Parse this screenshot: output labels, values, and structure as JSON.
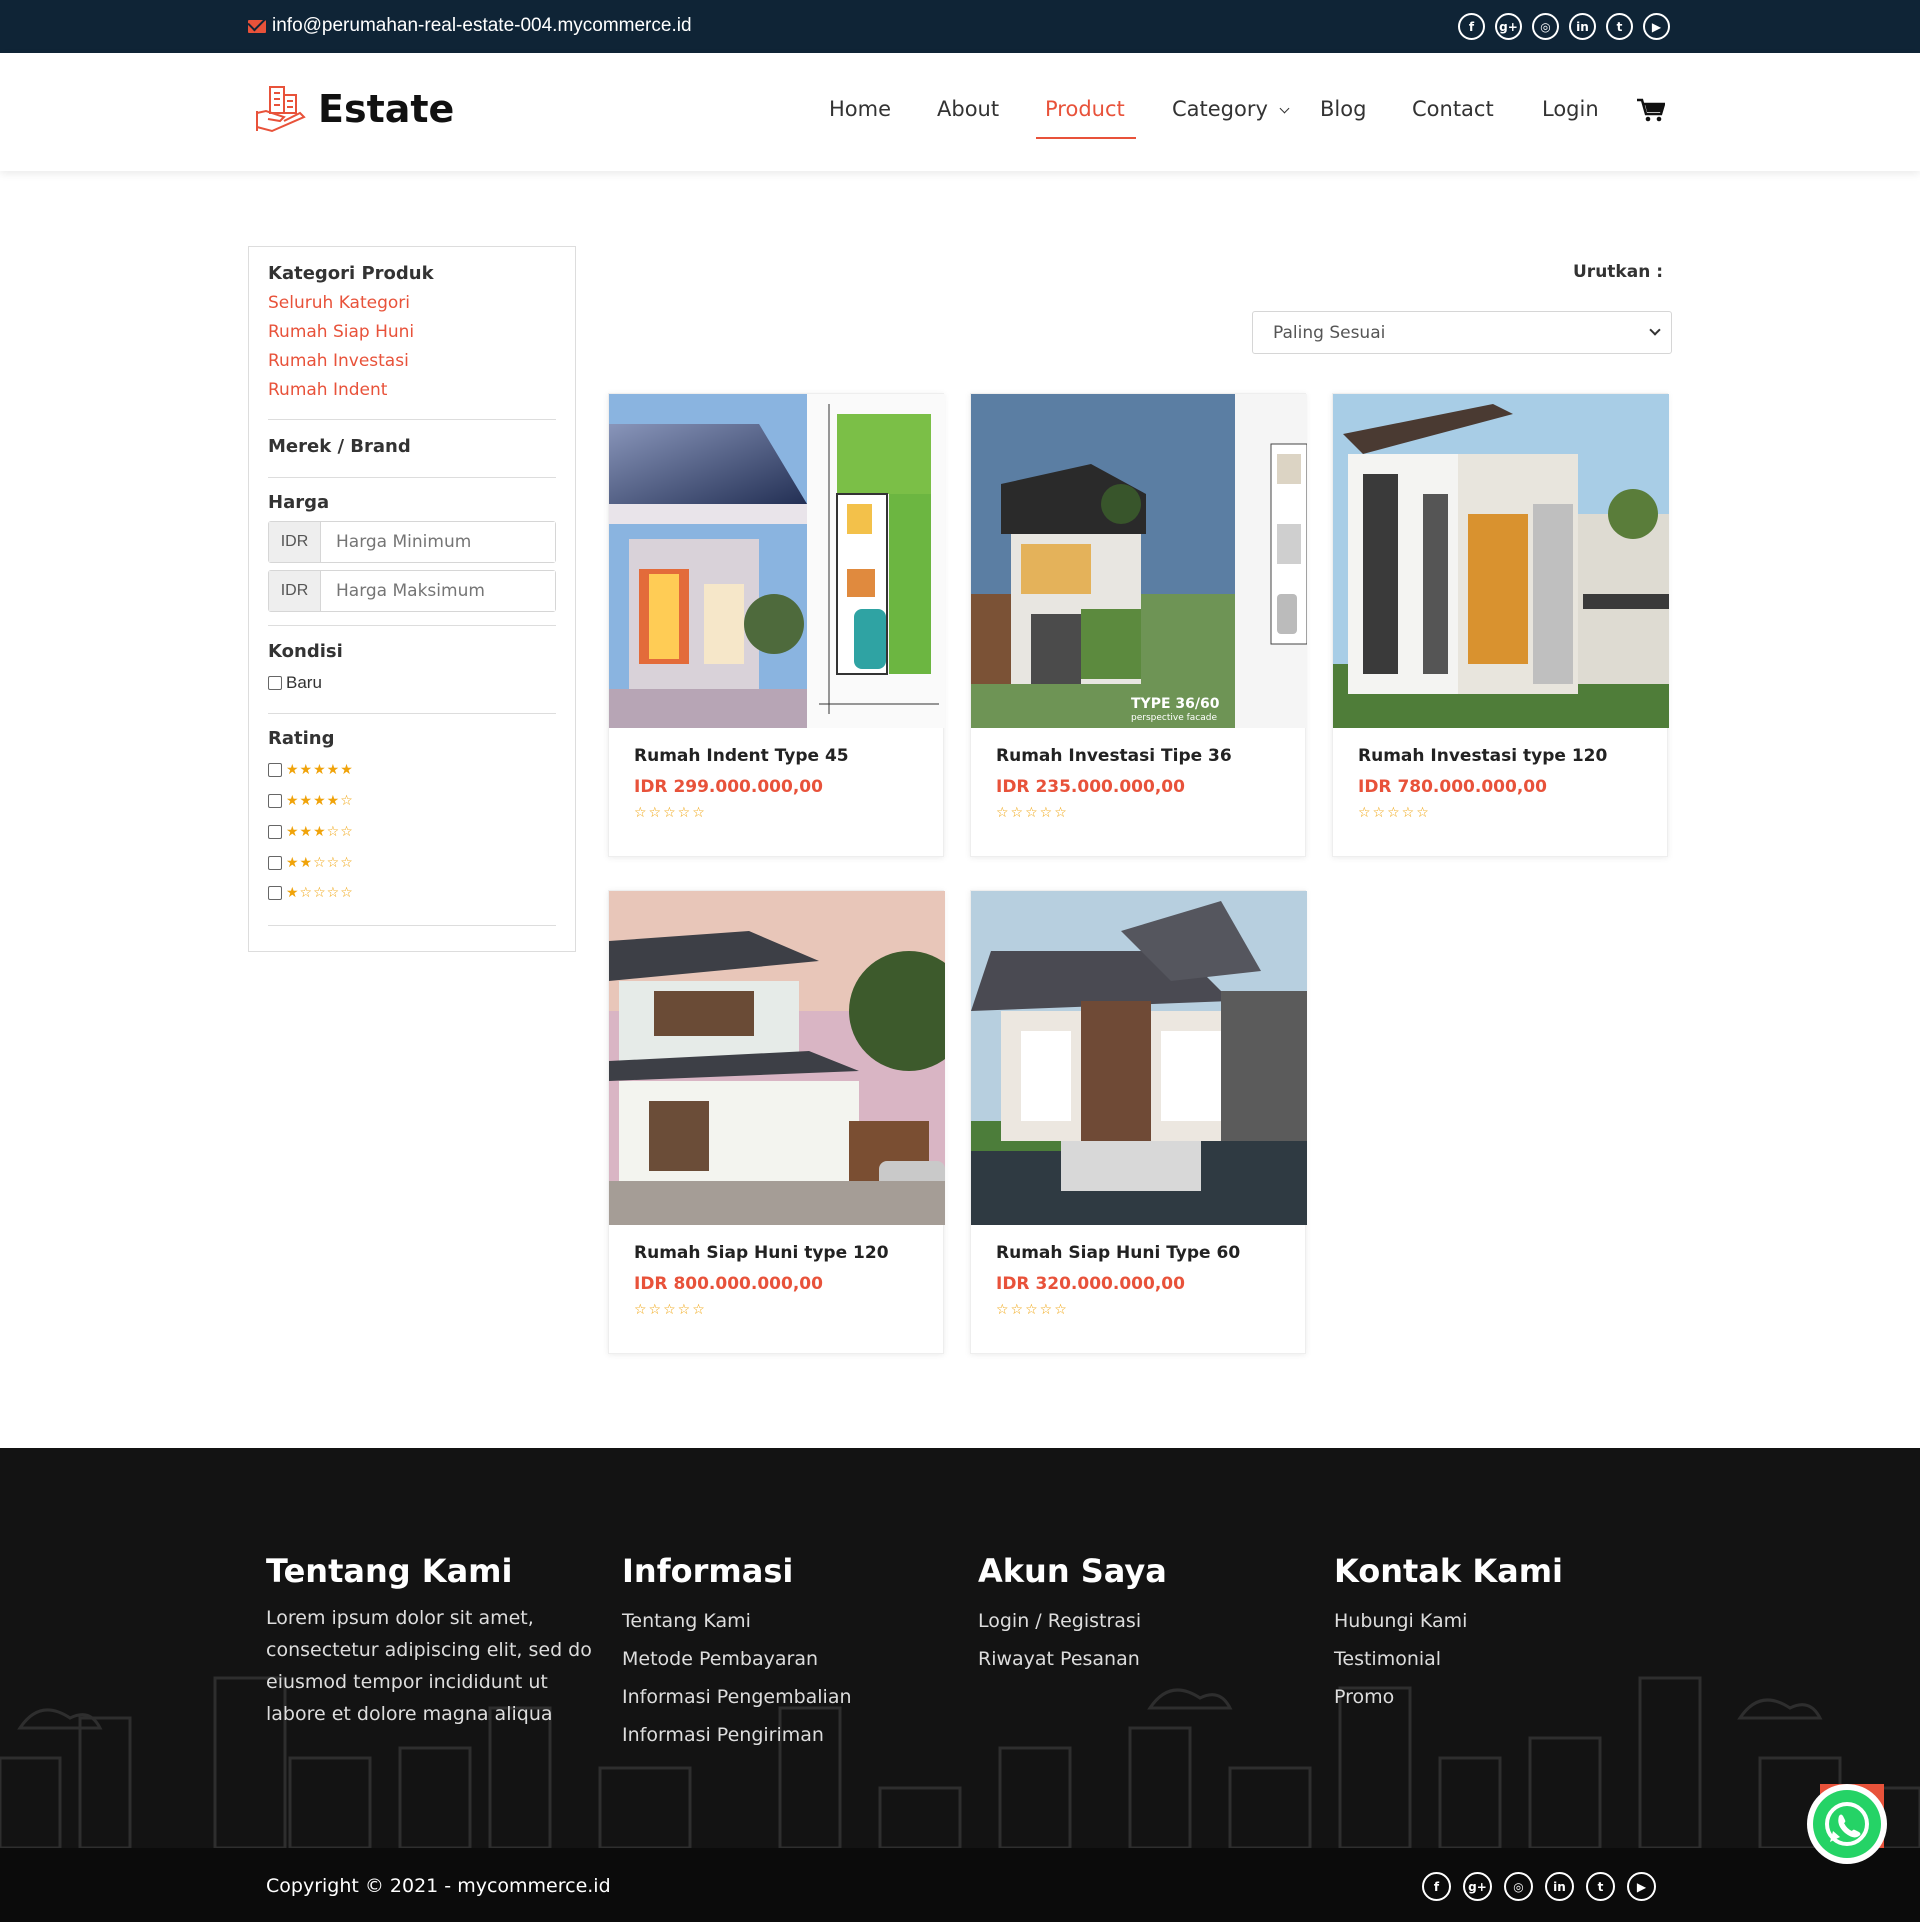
{
  "topbar": {
    "email": "info@perumahan-real-estate-004.mycommerce.id",
    "social": [
      {
        "icon": "facebook-icon",
        "glyph": "f"
      },
      {
        "icon": "google-plus-icon",
        "glyph": "g+"
      },
      {
        "icon": "instagram-icon",
        "glyph": "◎"
      },
      {
        "icon": "linkedin-icon",
        "glyph": "in"
      },
      {
        "icon": "twitter-icon",
        "glyph": "t"
      },
      {
        "icon": "youtube-icon",
        "glyph": "▶"
      }
    ]
  },
  "brand": {
    "name": "Estate",
    "accent": "#e8523a",
    "navy": "#0f2436"
  },
  "nav": {
    "items": [
      "Home",
      "About",
      "Product",
      "Category",
      "Blog",
      "Contact",
      "Login"
    ],
    "active": "Product"
  },
  "sidebar": {
    "category_title": "Kategori Produk",
    "categories": [
      "Seluruh Kategori",
      "Rumah Siap Huni",
      "Rumah Investasi",
      "Rumah Indent"
    ],
    "brand_title": "Merek / Brand",
    "price_title": "Harga",
    "currency": "IDR",
    "min_placeholder": "Harga Minimum",
    "max_placeholder": "Harga Maksimum",
    "condition_title": "Kondisi",
    "condition_option": "Baru",
    "rating_title": "Rating",
    "ratings": [
      "★★★★★",
      "★★★★☆",
      "★★★☆☆",
      "★★☆☆☆",
      "★☆☆☆☆"
    ]
  },
  "sort": {
    "label": "Urutkan :",
    "selected": "Paling Sesuai"
  },
  "products": [
    {
      "name": "Rumah Indent Type 45",
      "price": "IDR 299.000.000,00",
      "stars": "☆☆☆☆☆"
    },
    {
      "name": "Rumah Investasi Tipe 36",
      "price": "IDR 235.000.000,00",
      "stars": "☆☆☆☆☆",
      "image_caption": "TYPE 36/60",
      "image_subcaption": "perspective facade"
    },
    {
      "name": "Rumah Investasi type 120",
      "price": "IDR 780.000.000,00",
      "stars": "☆☆☆☆☆"
    },
    {
      "name": "Rumah Siap Huni type 120",
      "price": "IDR 800.000.000,00",
      "stars": "☆☆☆☆☆"
    },
    {
      "name": "Rumah Siap Huni Type 60",
      "price": "IDR 320.000.000,00",
      "stars": "☆☆☆☆☆"
    }
  ],
  "footer": {
    "about": {
      "title": "Tentang Kami",
      "text": "Lorem ipsum dolor sit amet, consectetur adipiscing elit, sed do eiusmod tempor incididunt ut labore et dolore magna aliqua"
    },
    "info": {
      "title": "Informasi",
      "links": [
        "Tentang Kami",
        "Metode Pembayaran",
        "Informasi Pengembalian",
        "Informasi Pengiriman"
      ]
    },
    "account": {
      "title": "Akun Saya",
      "links": [
        "Login / Registrasi",
        "Riwayat Pesanan"
      ]
    },
    "contact": {
      "title": "Kontak Kami",
      "links": [
        "Hubungi Kami",
        "Testimonial",
        "Promo"
      ]
    },
    "copyright": "Copyright © 2021 - mycommerce.id"
  }
}
